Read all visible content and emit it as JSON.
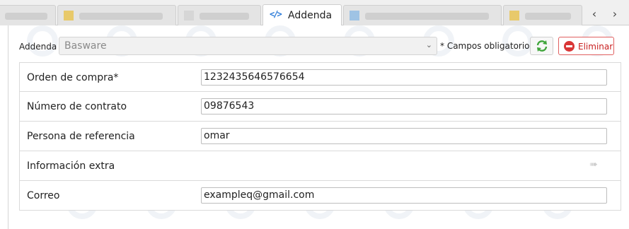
{
  "tabs": [
    {
      "label": "Addenda",
      "active": true
    }
  ],
  "nav": {
    "prev_icon": "chevron-left-icon",
    "next_icon": "chevron-right-icon",
    "prev": "‹",
    "next": "›"
  },
  "toolbar": {
    "addenda_label": "Addenda",
    "addenda_value": "Basware",
    "required_note": "* Campos obligatorios",
    "delete_label": "Eliminar"
  },
  "fields": [
    {
      "label": "Orden de compra*",
      "value": "1232435646576654"
    },
    {
      "label": "Número de contrato",
      "value": "09876543"
    },
    {
      "label": "Persona de referencia",
      "value": "omar"
    },
    {
      "label": "Información extra",
      "value": null
    },
    {
      "label": "Correo",
      "value": "exampleq@gmail.com"
    }
  ],
  "colors": {
    "accent": "#2a7ad8",
    "danger": "#d93636",
    "refresh": "#3fa53a"
  }
}
